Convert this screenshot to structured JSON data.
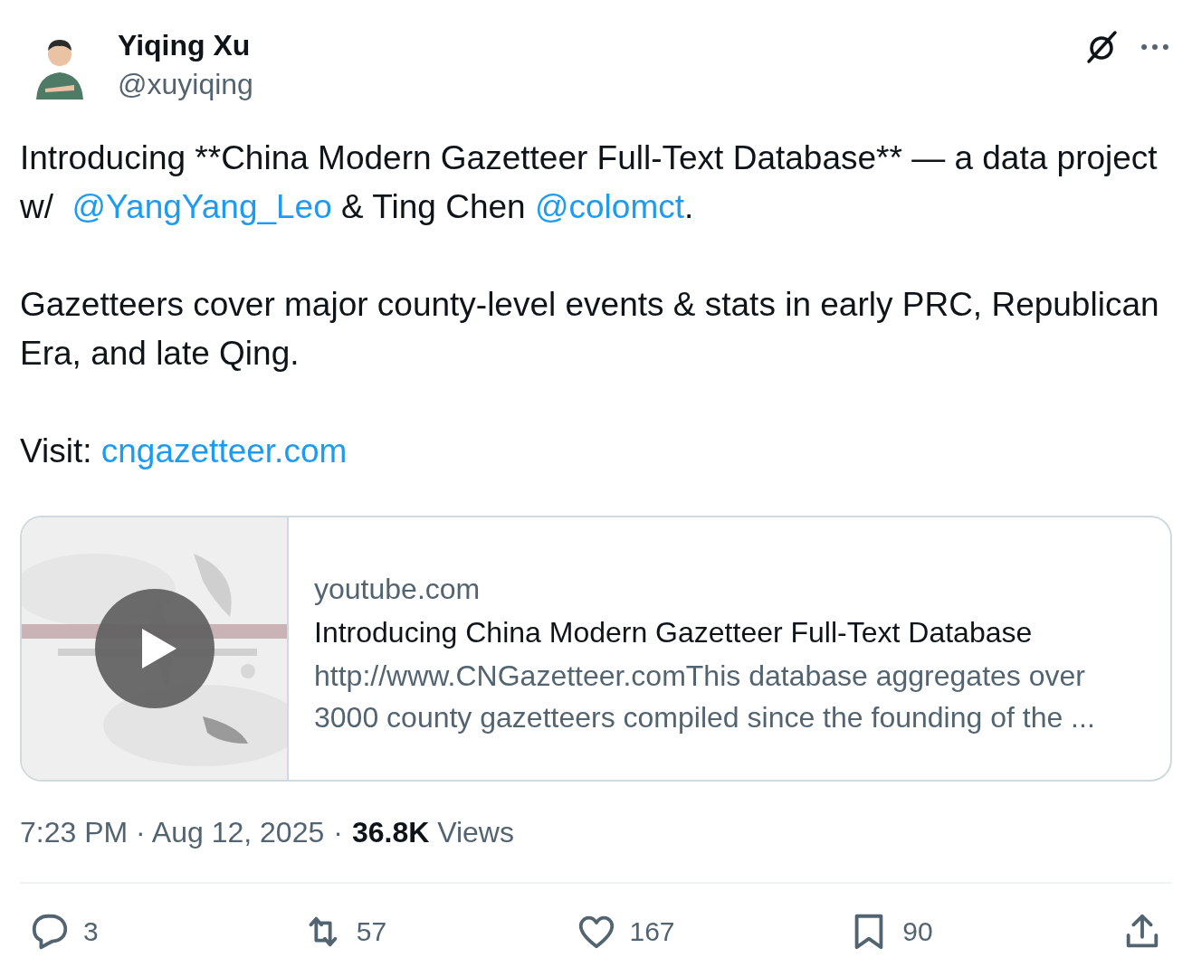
{
  "author": {
    "name": "Yiqing Xu",
    "handle": "@xuyiqing"
  },
  "paragraphs": [
    [
      {
        "kind": "text",
        "text": "Introducing **China Modern Gazetteer Full-Text Database** — a data project w/  "
      },
      {
        "kind": "link",
        "text": "@YangYang_Leo"
      },
      {
        "kind": "text",
        "text": " & Ting Chen "
      },
      {
        "kind": "link",
        "text": "@colomct"
      },
      {
        "kind": "text",
        "text": "."
      }
    ],
    [
      {
        "kind": "text",
        "text": "Gazetteers cover major county-level events & stats in early PRC, Republican Era, and late Qing."
      }
    ],
    [
      {
        "kind": "text",
        "text": "Visit: "
      },
      {
        "kind": "link",
        "text": "cngazetteer.com"
      }
    ]
  ],
  "card": {
    "domain": "youtube.com",
    "title": "Introducing China Modern Gazetteer Full-Text Database",
    "description": "http://www.CNGazetteer.comThis database aggregates over 3000 county gazetteers compiled since the founding of the ..."
  },
  "meta": {
    "time": "7:23 PM · Aug 12, 2025",
    "separator": "·",
    "views_count": "36.8K",
    "views_label": "Views"
  },
  "actions": [
    {
      "kind": "reply",
      "count": "3"
    },
    {
      "kind": "repost",
      "count": "57"
    },
    {
      "kind": "like",
      "count": "167"
    },
    {
      "kind": "bookmark",
      "count": "90"
    },
    {
      "kind": "share"
    }
  ]
}
